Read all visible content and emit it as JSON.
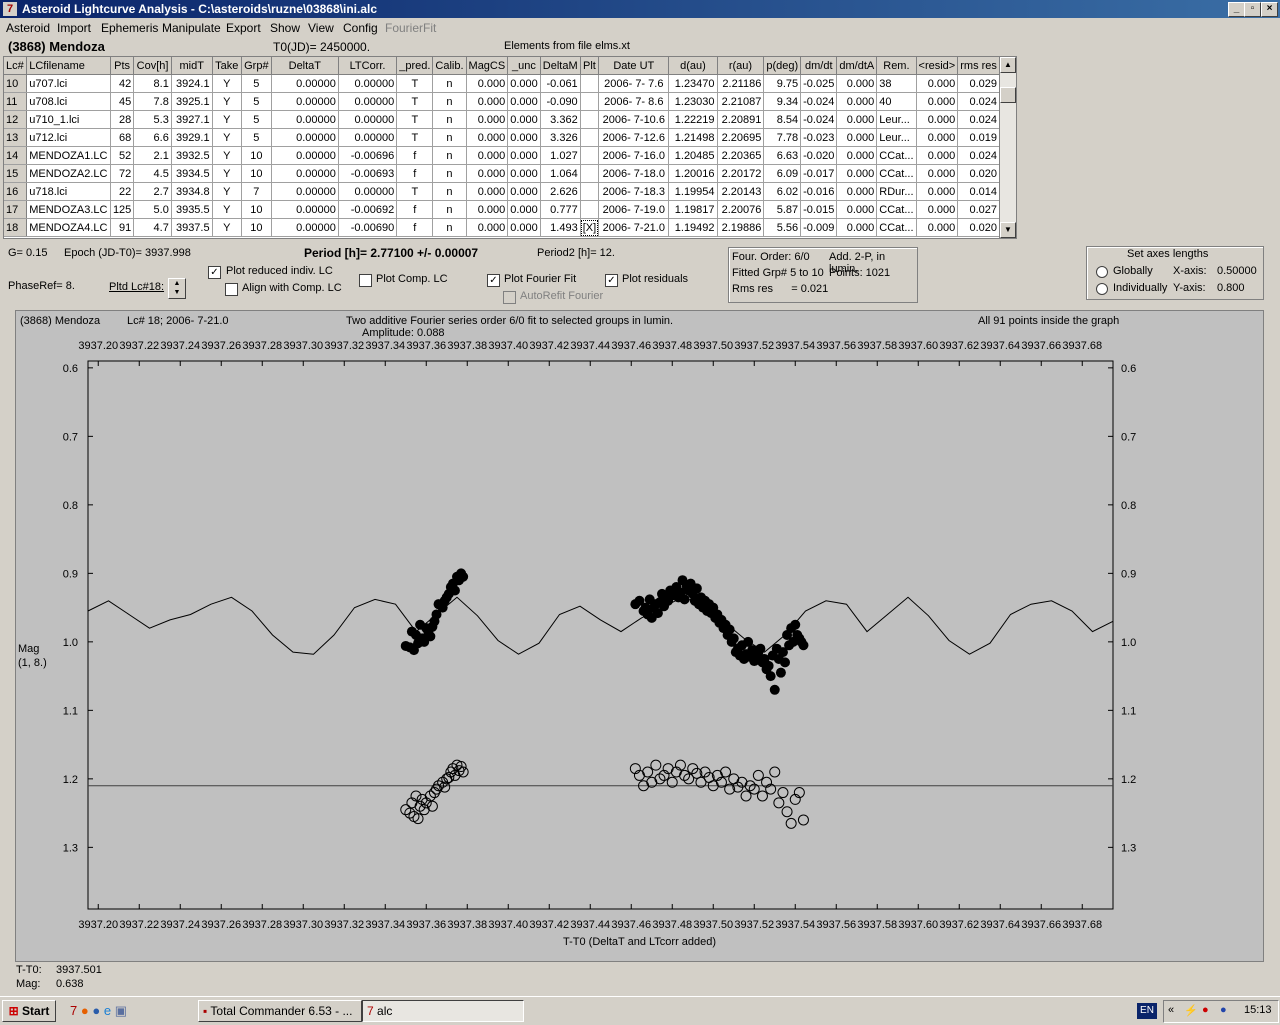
{
  "window": {
    "title": "Asteroid Lightcurve Analysis - C:\\asteroids\\ruzne\\03868\\ini.alc"
  },
  "menu": [
    "Asteroid",
    "Import",
    "Ephemeris",
    "Manipulate",
    "Export",
    "Show",
    "View",
    "Config",
    "FourierFit"
  ],
  "info": {
    "asteroid": "(3868) Mendoza",
    "t0": "T0(JD)= 2450000.",
    "elements": "Elements from file elms.xt"
  },
  "table": {
    "headers": [
      "Lc#",
      "LCfilename",
      "Pts",
      "Cov[h]",
      "midT",
      "Take",
      "Grp#",
      "DeltaT",
      "LTCorr.",
      "_pred.",
      "Calib.",
      "MagCS",
      "_unc",
      "DeltaM",
      "Plt",
      "Date UT",
      "d(au)",
      "r(au)",
      "p(deg)",
      "dm/dt",
      "dm/dtA",
      "Rem.",
      "<resid>",
      "rms res"
    ],
    "rows": [
      [
        "10",
        "u707.lci",
        "42",
        "8.1",
        "3924.1",
        "Y",
        "5",
        "0.00000",
        "0.00000",
        "T",
        "n",
        "0.000",
        "0.000",
        "-0.061",
        "",
        "2006- 7- 7.6",
        "1.23470",
        "2.21186",
        "9.75",
        "-0.025",
        "0.000",
        "38",
        "0.000",
        "0.029"
      ],
      [
        "11",
        "u708.lci",
        "45",
        "7.8",
        "3925.1",
        "Y",
        "5",
        "0.00000",
        "0.00000",
        "T",
        "n",
        "0.000",
        "0.000",
        "-0.090",
        "",
        "2006- 7- 8.6",
        "1.23030",
        "2.21087",
        "9.34",
        "-0.024",
        "0.000",
        "40",
        "0.000",
        "0.024"
      ],
      [
        "12",
        "u710_1.lci",
        "28",
        "5.3",
        "3927.1",
        "Y",
        "5",
        "0.00000",
        "0.00000",
        "T",
        "n",
        "0.000",
        "0.000",
        "3.362",
        "",
        "2006- 7-10.6",
        "1.22219",
        "2.20891",
        "8.54",
        "-0.024",
        "0.000",
        "Leur...",
        "0.000",
        "0.024"
      ],
      [
        "13",
        "u712.lci",
        "68",
        "6.6",
        "3929.1",
        "Y",
        "5",
        "0.00000",
        "0.00000",
        "T",
        "n",
        "0.000",
        "0.000",
        "3.326",
        "",
        "2006- 7-12.6",
        "1.21498",
        "2.20695",
        "7.78",
        "-0.023",
        "0.000",
        "Leur...",
        "0.000",
        "0.019"
      ],
      [
        "14",
        "MENDOZA1.LC",
        "52",
        "2.1",
        "3932.5",
        "Y",
        "10",
        "0.00000",
        "-0.00696",
        "f",
        "n",
        "0.000",
        "0.000",
        "1.027",
        "",
        "2006- 7-16.0",
        "1.20485",
        "2.20365",
        "6.63",
        "-0.020",
        "0.000",
        "CCat...",
        "0.000",
        "0.024"
      ],
      [
        "15",
        "MENDOZA2.LC",
        "72",
        "4.5",
        "3934.5",
        "Y",
        "10",
        "0.00000",
        "-0.00693",
        "f",
        "n",
        "0.000",
        "0.000",
        "1.064",
        "",
        "2006- 7-18.0",
        "1.20016",
        "2.20172",
        "6.09",
        "-0.017",
        "0.000",
        "CCat...",
        "0.000",
        "0.020"
      ],
      [
        "16",
        "u718.lci",
        "22",
        "2.7",
        "3934.8",
        "Y",
        "7",
        "0.00000",
        "0.00000",
        "T",
        "n",
        "0.000",
        "0.000",
        "2.626",
        "",
        "2006- 7-18.3",
        "1.19954",
        "2.20143",
        "6.02",
        "-0.016",
        "0.000",
        "RDur...",
        "0.000",
        "0.014"
      ],
      [
        "17",
        "MENDOZA3.LC",
        "125",
        "5.0",
        "3935.5",
        "Y",
        "10",
        "0.00000",
        "-0.00692",
        "f",
        "n",
        "0.000",
        "0.000",
        "0.777",
        "",
        "2006- 7-19.0",
        "1.19817",
        "2.20076",
        "5.87",
        "-0.015",
        "0.000",
        "CCat...",
        "0.000",
        "0.027"
      ],
      [
        "18",
        "MENDOZA4.LC",
        "91",
        "4.7",
        "3937.5",
        "Y",
        "10",
        "0.00000",
        "-0.00690",
        "f",
        "n",
        "0.000",
        "0.000",
        "1.493",
        "[X]",
        "2006- 7-21.0",
        "1.19492",
        "2.19886",
        "5.56",
        "-0.009",
        "0.000",
        "CCat...",
        "0.000",
        "0.020"
      ]
    ]
  },
  "params": {
    "g": "G= 0.15",
    "epoch": "Epoch (JD-T0)= 3937.998",
    "period": "Period [h]= 2.77100 +/- 0.00007",
    "period2": "Period2 [h]= 12.",
    "phaseref": "PhaseRef= 8.",
    "pltd": "Pltd Lc#18:"
  },
  "checks": {
    "plot_reduced": "Plot reduced indiv. LC",
    "align_comp": "Align with Comp. LC",
    "plot_comp": "Plot Comp. LC",
    "plot_fourier": "Plot Fourier Fit",
    "autorefit": "AutoRefit Fourier",
    "plot_residuals": "Plot residuals"
  },
  "fourier_box": {
    "order": "Four. Order:  6/0",
    "add": "Add. 2-P, in lumin.",
    "fitted": "Fitted Grp# 5 to 10",
    "points": "Points: 1021",
    "rms": "Rms res      = 0.021"
  },
  "axes_box": {
    "title": "Set axes lengths",
    "globally": "Globally",
    "individually": "Individually",
    "xlabel": "X-axis:",
    "xval": "0.50000",
    "ylabel": "Y-axis:",
    "yval": "0.800"
  },
  "plot": {
    "name": "(3868) Mendoza",
    "lc": "Lc# 18; 2006- 7-21.0",
    "fit_desc": "Two additive Fourier series order 6/0 fit to selected groups in lumin.",
    "amplitude": "Amplitude: 0.088",
    "inside": "All 91 points inside the graph",
    "xlabel": "T-T0 (DeltaT and LTcorr added)",
    "ylabel1": "Mag",
    "ylabel2": "(1, 8.)"
  },
  "readout": {
    "tt0_label": "T-T0:",
    "tt0": "3937.501",
    "mag_label": "Mag:",
    "mag": "0.638"
  },
  "chart_data": {
    "type": "scatter",
    "title": "Two additive Fourier series order 6/0 fit to selected groups in lumin.",
    "xlabel": "T-T0 (DeltaT and LTcorr added)",
    "ylabel": "Mag",
    "xlim": [
      3937.195,
      3937.695
    ],
    "ylim": [
      0.59,
      1.39
    ],
    "x_ticks": [
      "3937.20",
      "3937.22",
      "3937.24",
      "3937.26",
      "3937.28",
      "3937.30",
      "3937.32",
      "3937.34",
      "3937.36",
      "3937.38",
      "3937.40",
      "3937.42",
      "3937.44",
      "3937.46",
      "3937.48",
      "3937.50",
      "3937.52",
      "3937.54",
      "3937.56",
      "3937.58",
      "3937.60",
      "3937.62",
      "3937.64",
      "3937.66",
      "3937.68"
    ],
    "y_ticks": [
      "0.6",
      "0.7",
      "0.8",
      "0.9",
      "1.0",
      "1.1",
      "1.2",
      "1.3"
    ],
    "series": [
      {
        "x": [
          3937.35,
          3937.352,
          3937.353,
          3937.354,
          3937.355,
          3937.356,
          3937.357,
          3937.358,
          3937.359,
          3937.36,
          3937.361,
          3937.362,
          3937.363,
          3937.364,
          3937.365,
          3937.366,
          3937.368,
          3937.369,
          3937.37,
          3937.371,
          3937.372,
          3937.373,
          3937.374,
          3937.375,
          3937.376,
          3937.377,
          3937.378
        ],
        "y": [
          1.006,
          1.008,
          0.985,
          1.012,
          0.99,
          1.002,
          0.975,
          0.995,
          1.0,
          0.98,
          0.985,
          0.992,
          0.978,
          0.97,
          0.96,
          0.945,
          0.95,
          0.94,
          0.935,
          0.93,
          0.92,
          0.915,
          0.925,
          0.905,
          0.91,
          0.9,
          0.905
        ]
      },
      {
        "x": [
          3937.462,
          3937.464,
          3937.466,
          3937.467,
          3937.468,
          3937.469,
          3937.47,
          3937.471,
          3937.472,
          3937.473,
          3937.474,
          3937.475,
          3937.476,
          3937.477,
          3937.478,
          3937.479,
          3937.48,
          3937.481,
          3937.482,
          3937.483,
          3937.484,
          3937.485,
          3937.486,
          3937.487,
          3937.488,
          3937.489,
          3937.49,
          3937.491,
          3937.492,
          3937.493,
          3937.494,
          3937.495,
          3937.496,
          3937.497,
          3937.498,
          3937.499,
          3937.5,
          3937.501,
          3937.502,
          3937.503,
          3937.504,
          3937.505,
          3937.506,
          3937.507,
          3937.508,
          3937.509,
          3937.51,
          3937.511,
          3937.512,
          3937.513,
          3937.514,
          3937.515,
          3937.516,
          3937.517,
          3937.518,
          3937.519,
          3937.52,
          3937.521,
          3937.522,
          3937.523,
          3937.524,
          3937.525,
          3937.526,
          3937.527,
          3937.528,
          3937.529,
          3937.53,
          3937.531,
          3937.532,
          3937.533,
          3937.534,
          3937.535,
          3937.536,
          3937.537,
          3937.538,
          3937.539,
          3937.54,
          3937.541,
          3937.542,
          3937.543,
          3937.544
        ],
        "y": [
          0.945,
          0.94,
          0.955,
          0.95,
          0.96,
          0.938,
          0.965,
          0.95,
          0.945,
          0.958,
          0.942,
          0.93,
          0.948,
          0.935,
          0.94,
          0.925,
          0.932,
          0.93,
          0.92,
          0.935,
          0.928,
          0.91,
          0.938,
          0.918,
          0.925,
          0.915,
          0.93,
          0.94,
          0.922,
          0.945,
          0.935,
          0.95,
          0.94,
          0.955,
          0.945,
          0.958,
          0.95,
          0.965,
          0.96,
          0.972,
          0.968,
          0.98,
          0.975,
          0.99,
          0.982,
          1.0,
          0.995,
          1.015,
          1.01,
          1.02,
          1.005,
          1.025,
          1.018,
          1.0,
          1.022,
          1.012,
          1.028,
          1.02,
          1.015,
          1.01,
          1.03,
          1.025,
          1.04,
          1.035,
          1.05,
          1.02,
          1.07,
          1.01,
          1.025,
          1.045,
          1.015,
          1.03,
          0.99,
          1.005,
          0.98,
          1.0,
          0.975,
          0.99,
          0.995,
          1.0,
          1.005
        ]
      }
    ],
    "residuals": {
      "baseline": 1.21,
      "x": [
        3937.35,
        3937.352,
        3937.353,
        3937.354,
        3937.355,
        3937.356,
        3937.357,
        3937.358,
        3937.359,
        3937.36,
        3937.362,
        3937.363,
        3937.364,
        3937.365,
        3937.366,
        3937.368,
        3937.369,
        3937.37,
        3937.371,
        3937.372,
        3937.373,
        3937.374,
        3937.375,
        3937.376,
        3937.377,
        3937.378,
        3937.462,
        3937.464,
        3937.466,
        3937.468,
        3937.47,
        3937.472,
        3937.474,
        3937.476,
        3937.478,
        3937.48,
        3937.482,
        3937.484,
        3937.486,
        3937.488,
        3937.49,
        3937.492,
        3937.494,
        3937.496,
        3937.498,
        3937.5,
        3937.502,
        3937.504,
        3937.506,
        3937.508,
        3937.51,
        3937.512,
        3937.514,
        3937.516,
        3937.518,
        3937.52,
        3937.522,
        3937.524,
        3937.526,
        3937.528,
        3937.53,
        3937.532,
        3937.534,
        3937.536,
        3937.538,
        3937.54,
        3937.542,
        3937.544
      ],
      "y": [
        1.245,
        1.25,
        1.235,
        1.255,
        1.225,
        1.258,
        1.24,
        1.23,
        1.245,
        1.235,
        1.225,
        1.24,
        1.22,
        1.215,
        1.21,
        1.205,
        1.212,
        1.2,
        1.198,
        1.19,
        1.185,
        1.195,
        1.18,
        1.188,
        1.182,
        1.19,
        1.185,
        1.195,
        1.21,
        1.19,
        1.205,
        1.18,
        1.2,
        1.195,
        1.185,
        1.205,
        1.19,
        1.18,
        1.195,
        1.2,
        1.185,
        1.192,
        1.205,
        1.19,
        1.198,
        1.21,
        1.195,
        1.205,
        1.19,
        1.215,
        1.2,
        1.212,
        1.205,
        1.225,
        1.21,
        1.215,
        1.195,
        1.225,
        1.205,
        1.215,
        1.19,
        1.235,
        1.22,
        1.248,
        1.265,
        1.23,
        1.22,
        1.26
      ]
    },
    "fourier_fit": {
      "x": [
        3937.195,
        3937.205,
        3937.215,
        3937.225,
        3937.235,
        3937.245,
        3937.255,
        3937.265,
        3937.275,
        3937.285,
        3937.295,
        3937.305,
        3937.315,
        3937.325,
        3937.335,
        3937.345,
        3937.355,
        3937.365,
        3937.375,
        3937.385,
        3937.395,
        3937.405,
        3937.415,
        3937.425,
        3937.435,
        3937.445,
        3937.455,
        3937.465,
        3937.475,
        3937.485,
        3937.495,
        3937.505,
        3937.515,
        3937.525,
        3937.535,
        3937.545,
        3937.555,
        3937.565,
        3937.575,
        3937.585,
        3937.595,
        3937.605,
        3937.615,
        3937.625,
        3937.635,
        3937.645,
        3937.655,
        3937.665,
        3937.675,
        3937.685,
        3937.695
      ],
      "y": [
        0.955,
        0.94,
        0.96,
        0.98,
        0.968,
        0.96,
        0.945,
        0.935,
        0.955,
        0.99,
        1.015,
        1.018,
        0.99,
        0.95,
        0.938,
        0.945,
        0.985,
        0.96,
        0.935,
        0.962,
        0.998,
        1.018,
        1.002,
        0.96,
        0.948,
        0.968,
        0.985,
        0.965,
        0.95,
        0.935,
        0.945,
        0.97,
        0.995,
        1.015,
        0.99,
        0.955,
        0.94,
        0.945,
        0.985,
        0.96,
        0.935,
        0.962,
        0.998,
        1.018,
        1.002,
        0.96,
        0.945,
        0.94,
        0.955,
        0.985,
        0.97
      ]
    }
  },
  "taskbar": {
    "start": "Start",
    "task1": "Total Commander 6.53 - ...",
    "task2": "alc",
    "lang": "EN",
    "clock": "15:13"
  }
}
